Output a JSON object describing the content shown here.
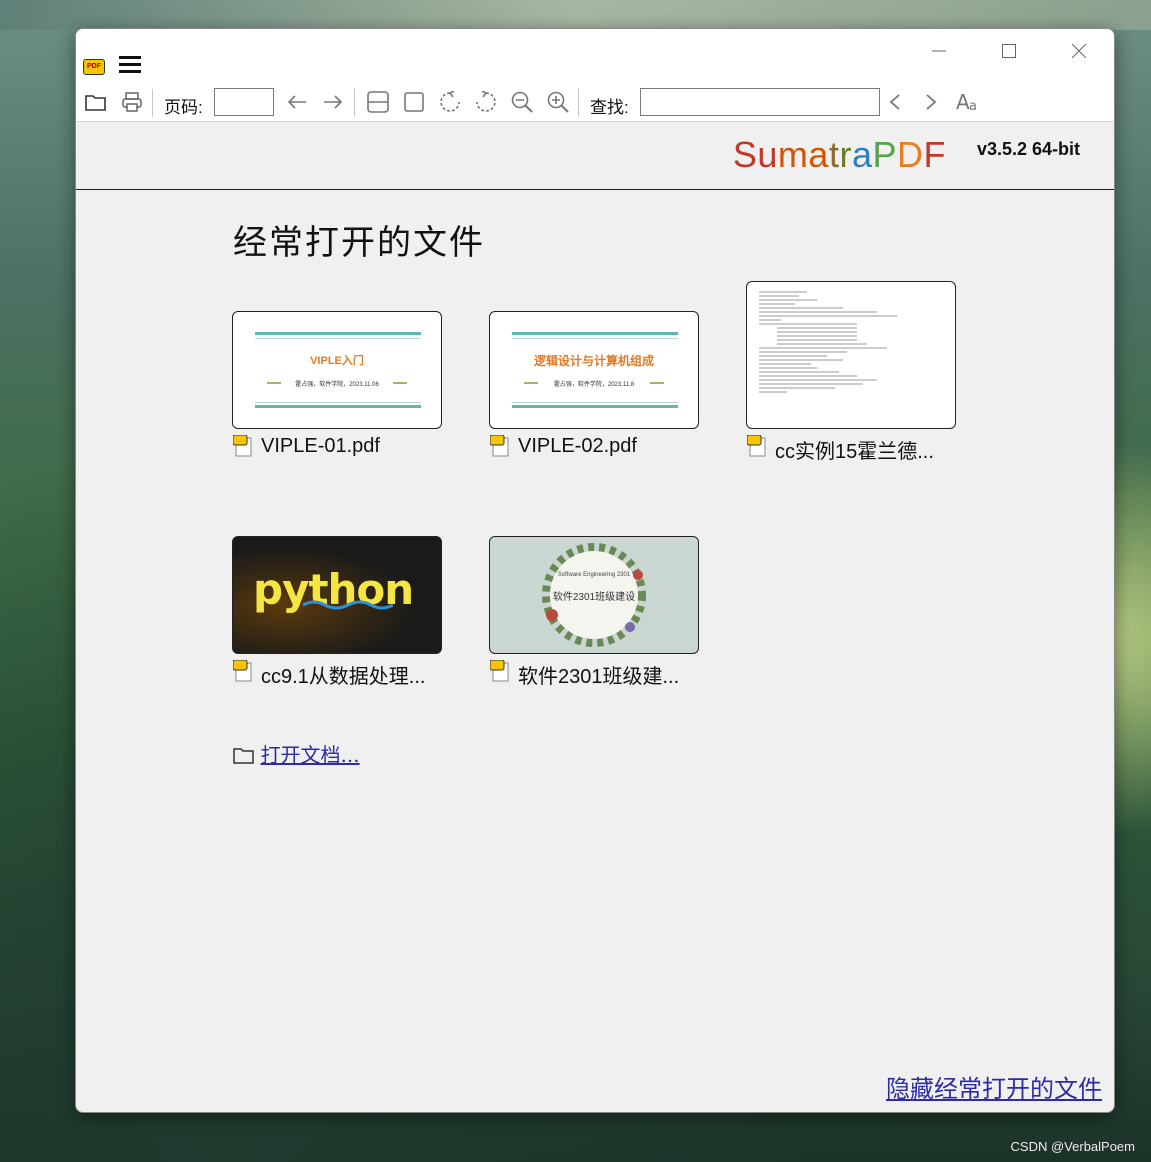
{
  "window": {
    "menu_icon": "hamburger-icon",
    "app_icon_text": "PDF",
    "controls": [
      "minimize-icon",
      "maximize-icon",
      "close-icon"
    ]
  },
  "toolbar": {
    "page_label": "页码:",
    "page_value": "",
    "find_label": "查找:",
    "find_value": "",
    "icons": [
      "open-folder-icon",
      "print-icon",
      "back-arrow-icon",
      "forward-arrow-icon",
      "single-page-icon",
      "fit-page-icon",
      "rotate-left-icon",
      "rotate-right-icon",
      "zoom-out-icon",
      "zoom-in-icon",
      "find-prev-icon",
      "find-next-icon",
      "match-case-icon"
    ]
  },
  "brand": {
    "letters": [
      {
        "t": "S",
        "c": "#c0392b"
      },
      {
        "t": "u",
        "c": "#c0392b"
      },
      {
        "t": "m",
        "c": "#d35400"
      },
      {
        "t": "a",
        "c": "#d35400"
      },
      {
        "t": "t",
        "c": "#8e6b2c"
      },
      {
        "t": "r",
        "c": "#6b7c2c"
      },
      {
        "t": "a",
        "c": "#2e7dbf"
      },
      {
        "t": "P",
        "c": "#55a34a"
      },
      {
        "t": "D",
        "c": "#e67e22"
      },
      {
        "t": "F",
        "c": "#c0392b"
      }
    ],
    "version": "v3.5.2 64-bit"
  },
  "main": {
    "heading": "经常打开的文件",
    "files": [
      {
        "name": "VIPLE-01.pdf",
        "thumb_title": "VIPLE入门",
        "thumb_sub": "霍占强，软件学院，2023.11.06"
      },
      {
        "name": "VIPLE-02.pdf",
        "thumb_title": "逻辑设计与计算机组成",
        "thumb_sub": "霍占强，软件学院，2023.11.8"
      },
      {
        "name": "cc实例15霍兰德...",
        "thumb_title": "",
        "thumb_sub": ""
      },
      {
        "name": "cc9.1从数据处理...",
        "thumb_title": "python",
        "thumb_sub": ""
      },
      {
        "name": "软件2301班级建...",
        "thumb_title": "软件2301班级建设",
        "thumb_sub": "Software Engineering 2301"
      }
    ],
    "open_doc": "打开文档...",
    "hide_recent": "隐藏经常打开的文件"
  },
  "watermark": "CSDN @VerbalPoem"
}
